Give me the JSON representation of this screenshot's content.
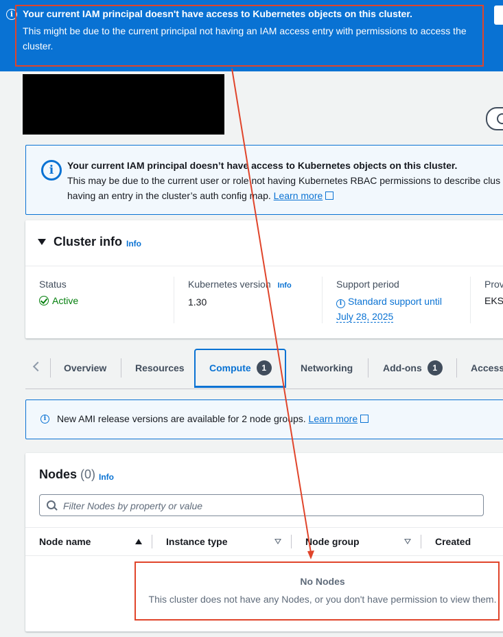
{
  "top_banner": {
    "title": "Your current IAM principal doesn't have access to Kubernetes objects on this cluster.",
    "body": "This might be due to the current principal not having an IAM access entry with permissions to access the cluster."
  },
  "iam_alert": {
    "title": "Your current IAM principal doesn’t have access to Kubernetes objects on this cluster.",
    "body_line1": "This may be due to the current user or role not having Kubernetes RBAC permissions to describe clus",
    "body_line2": "having an entry in the cluster’s auth config map.",
    "learn_more": "Learn more"
  },
  "cluster_info": {
    "heading": "Cluster info",
    "info": "Info",
    "status_label": "Status",
    "status_value": "Active",
    "k8s_label": "Kubernetes version",
    "k8s_info": "Info",
    "k8s_value": "1.30",
    "support_label": "Support period",
    "support_line1": "Standard support until",
    "support_line2": "July 28, 2025",
    "provider_label": "Prov",
    "provider_value": "EKS"
  },
  "tabs": [
    {
      "label": "Overview"
    },
    {
      "label": "Resources"
    },
    {
      "label": "Compute",
      "count": "1"
    },
    {
      "label": "Networking"
    },
    {
      "label": "Add-ons",
      "count": "1"
    },
    {
      "label": "Access"
    }
  ],
  "ami_alert": {
    "text": "New AMI release versions are available for 2 node groups.",
    "learn_more": "Learn more"
  },
  "nodes": {
    "heading": "Nodes",
    "count": "(0)",
    "info": "Info",
    "filter_placeholder": "Filter Nodes by property or value",
    "columns": [
      "Node name",
      "Instance type",
      "Node group",
      "Created"
    ],
    "empty_title": "No Nodes",
    "empty_desc": "This cluster does not have any Nodes, or you don't have permission to view them."
  },
  "colors": {
    "banner_blue": "#0972d3",
    "annotation_red": "#e0442a",
    "success_green": "#037f0c"
  }
}
